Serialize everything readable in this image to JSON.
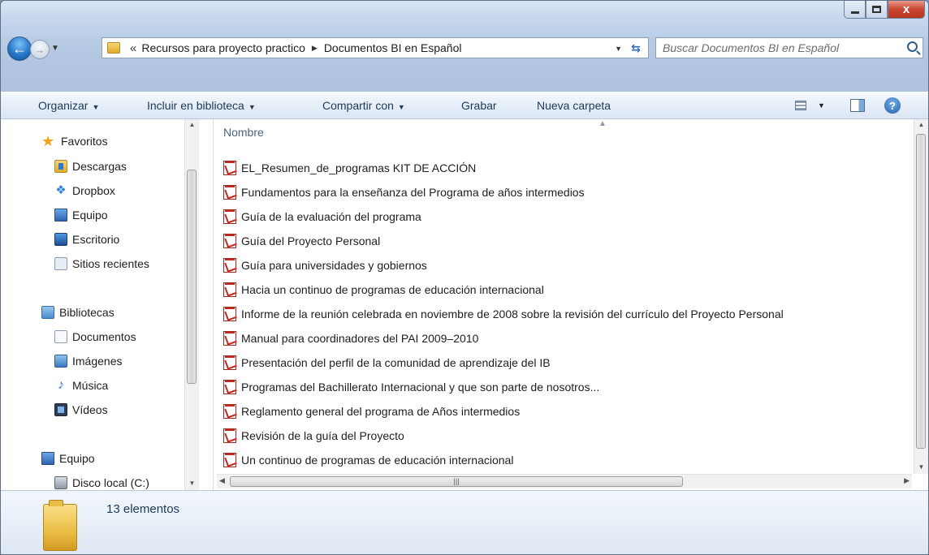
{
  "window": {
    "close_glyph": "x"
  },
  "address": {
    "overflow": "«",
    "crumbs": [
      "Recursos para proyecto practico",
      "Documentos BI en Español"
    ],
    "search_placeholder": "Buscar Documentos BI en Español"
  },
  "toolbar": {
    "organize": "Organizar",
    "include_library": "Incluir en biblioteca",
    "share_with": "Compartir con",
    "burn": "Grabar",
    "new_folder": "Nueva carpeta",
    "help": "?"
  },
  "nav": {
    "favorites": "Favoritos",
    "downloads": "Descargas",
    "dropbox": "Dropbox",
    "computer_fav": "Equipo",
    "desktop": "Escritorio",
    "recent": "Sitios recientes",
    "libraries": "Bibliotecas",
    "documents": "Documentos",
    "pictures": "Imágenes",
    "music": "Música",
    "videos": "Vídeos",
    "computer": "Equipo",
    "local_disk": "Disco local (C:)"
  },
  "main": {
    "column_name": "Nombre",
    "files": [
      "EL_Resumen_de_programas KIT DE ACCIÓN",
      "Fundamentos para la enseñanza del Programa de años intermedios",
      "Guía de la evaluación del programa",
      "Guía del Proyecto Personal",
      "Guía para universidades y gobiernos",
      "Hacia un continuo de programas de educación internacional",
      "Informe de la reunión celebrada en noviembre de 2008 sobre la revisión del currículo del Proyecto Personal",
      "Manual para coordinadores del PAI 2009–2010",
      "Presentación del perfil de la comunidad de aprendizaje del IB",
      "Programas del Bachillerato Internacional y que son parte de nosotros...",
      "Reglamento general del programa de Años intermedios",
      "Revisión de la guía del Proyecto",
      "Un continuo de programas de educación internacional"
    ]
  },
  "details": {
    "count": "13 elementos"
  },
  "icons": {
    "file_type": "pdf-icon",
    "favorites": "star-icon"
  },
  "colors": {
    "accent": "#2877c9",
    "pdf": "#c6261b",
    "close": "#c9452f"
  }
}
